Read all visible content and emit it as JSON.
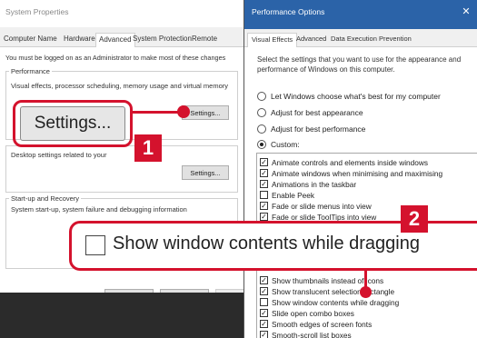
{
  "system_properties": {
    "title": "System Properties",
    "tabs": [
      "Computer Name",
      "Hardware",
      "Advanced",
      "System Protection",
      "Remote"
    ],
    "admin_note": "You must be logged on as an Administrator to make most of these changes",
    "performance": {
      "label": "Performance",
      "description": "Visual effects, processor scheduling, memory usage and virtual memory",
      "button": "Settings..."
    },
    "user_profiles": {
      "description": "Desktop settings related to your",
      "button": "Settings..."
    },
    "startup": {
      "label": "Start-up and Recovery",
      "description": "System start-up, system failure and debugging information"
    },
    "buttons": {
      "ok": "OK",
      "cancel": "Cancel",
      "apply": "Apply"
    }
  },
  "performance_options": {
    "title": "Performance Options",
    "close": "✕",
    "tabs": [
      "Visual Effects",
      "Advanced",
      "Data Execution Prevention"
    ],
    "description": "Select the settings that you want to use for the appearance and performance of Windows on this computer.",
    "radios": [
      {
        "label": "Let Windows choose what's best for my computer",
        "selected": false
      },
      {
        "label": "Adjust for best appearance",
        "selected": false
      },
      {
        "label": "Adjust for best performance",
        "selected": false
      },
      {
        "label": "Custom:",
        "selected": true
      }
    ],
    "effects_top": [
      {
        "label": "Animate controls and elements inside windows",
        "checked": true
      },
      {
        "label": "Animate windows when minimising and maximising",
        "checked": true
      },
      {
        "label": "Animations in the taskbar",
        "checked": true
      },
      {
        "label": "Enable Peek",
        "checked": false
      },
      {
        "label": "Fade or slide menus into view",
        "checked": true
      },
      {
        "label": "Fade or slide ToolTips into view",
        "checked": true
      }
    ],
    "effects_bottom": [
      {
        "label": "Show thumbnails instead of icons",
        "checked": true
      },
      {
        "label": "Show translucent selection rectangle",
        "checked": true
      },
      {
        "label": "Show window contents while dragging",
        "checked": false
      },
      {
        "label": "Slide open combo boxes",
        "checked": true
      },
      {
        "label": "Smooth edges of screen fonts",
        "checked": true
      },
      {
        "label": "Smooth-scroll list boxes",
        "checked": true
      }
    ]
  },
  "callouts": {
    "settings_zoom": "Settings...",
    "badge_1": "1",
    "badge_2": "2",
    "drag_zoom": "Show window contents while dragging"
  },
  "colors": {
    "callout_red": "#d4122d",
    "title_blue": "#2b63a8"
  }
}
